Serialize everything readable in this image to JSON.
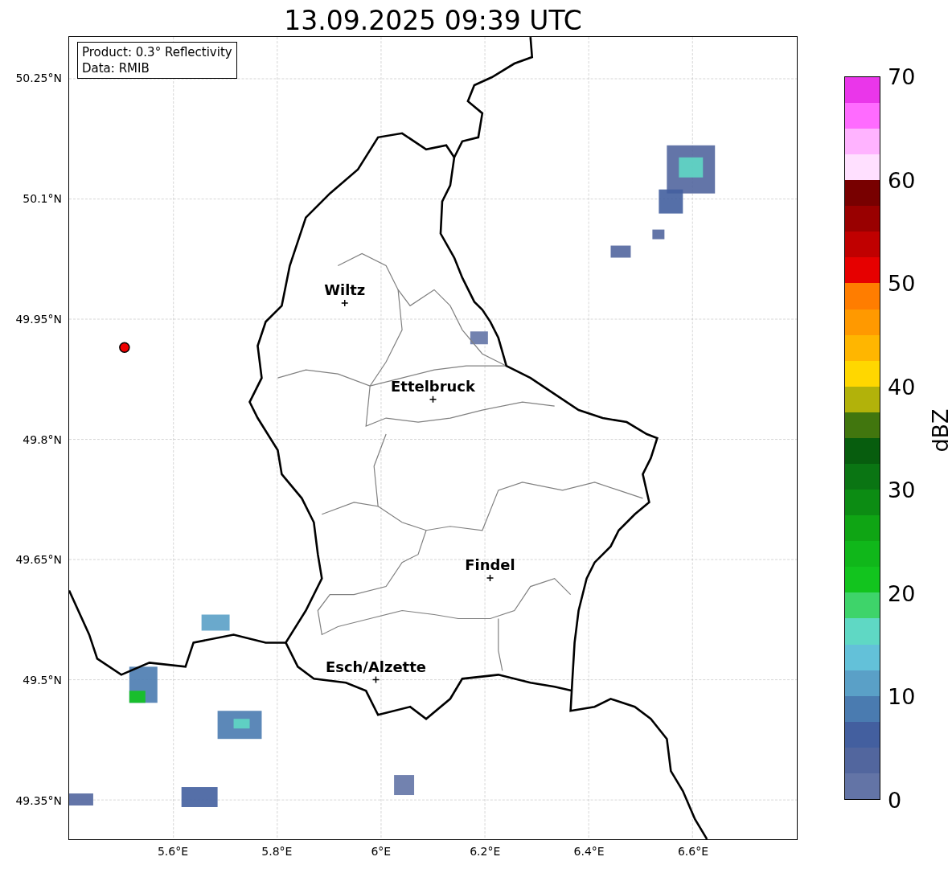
{
  "title": "13.09.2025 09:39 UTC",
  "info": [
    "Product: 0.3° Reflectivity",
    "Data: RMIB"
  ],
  "yticks": [
    "50.25°N",
    "50.1°N",
    "49.95°N",
    "49.8°N",
    "49.65°N",
    "49.5°N",
    "49.35°N"
  ],
  "xticks": [
    "5.6°E",
    "5.8°E",
    "6°E",
    "6.2°E",
    "6.4°E",
    "6.6°E"
  ],
  "cities": [
    {
      "name": "Wiltz"
    },
    {
      "name": "Ettelbruck"
    },
    {
      "name": "Findel"
    },
    {
      "name": "Esch/Alzette"
    }
  ],
  "colorbar": {
    "label": "dBZ",
    "ticks": [
      "70",
      "60",
      "50",
      "40",
      "30",
      "20",
      "10",
      "0"
    ],
    "bins": [
      {
        "color": "#6374a6"
      },
      {
        "color": "#52669e"
      },
      {
        "color": "#435f9f"
      },
      {
        "color": "#4a7bb0"
      },
      {
        "color": "#5aa0c7"
      },
      {
        "color": "#63c1d9"
      },
      {
        "color": "#5fd8c4"
      },
      {
        "color": "#3ed46a"
      },
      {
        "color": "#12c41e"
      },
      {
        "color": "#10b71a"
      },
      {
        "color": "#0fa514"
      },
      {
        "color": "#0c8c13"
      },
      {
        "color": "#0a7513"
      },
      {
        "color": "#075d0e"
      },
      {
        "color": "#41760e"
      },
      {
        "color": "#b2b20a"
      },
      {
        "color": "#ffd700"
      },
      {
        "color": "#ffb600"
      },
      {
        "color": "#ff9900"
      },
      {
        "color": "#ff7d00"
      },
      {
        "color": "#e60000"
      },
      {
        "color": "#c00000"
      },
      {
        "color": "#990000"
      },
      {
        "color": "#780000"
      },
      {
        "color": "#ffe0ff"
      },
      {
        "color": "#ffb3ff"
      },
      {
        "color": "#ff6bff"
      },
      {
        "color": "#ea36ea"
      }
    ]
  }
}
